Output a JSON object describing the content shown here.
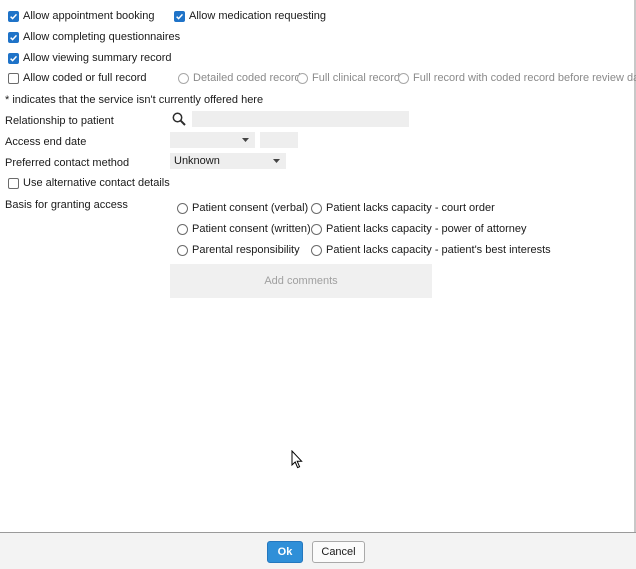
{
  "permissions": {
    "appointment_booking": {
      "label": "Allow appointment booking",
      "checked": true
    },
    "medication_requesting": {
      "label": "Allow medication requesting",
      "checked": true
    },
    "completing_questionnaires": {
      "label": "Allow completing questionnaires",
      "checked": true
    },
    "viewing_summary": {
      "label": "Allow viewing summary record",
      "checked": true
    },
    "coded_or_full": {
      "label": "Allow coded or full record",
      "checked": false
    }
  },
  "record_options": [
    {
      "label": "Detailed coded record"
    },
    {
      "label": "Full clinical record"
    },
    {
      "label": "Full record with coded record before review date"
    }
  ],
  "note": "* indicates that the service isn't currently offered here",
  "relationship": {
    "label": "Relationship to patient",
    "value": ""
  },
  "access_end_date": {
    "label": "Access end date",
    "date": "",
    "time": ""
  },
  "preferred_contact": {
    "label": "Preferred contact method",
    "value": "Unknown"
  },
  "alt_contact": {
    "label": "Use alternative contact details",
    "checked": false
  },
  "basis": {
    "label": "Basis for granting access",
    "col1": [
      "Patient consent (verbal)",
      "Patient consent (written)",
      "Parental responsibility"
    ],
    "col2": [
      "Patient lacks capacity - court order",
      "Patient lacks capacity - power of attorney",
      "Patient lacks capacity - patient's best interests"
    ]
  },
  "add_comments": "Add comments",
  "footer": {
    "ok": "Ok",
    "cancel": "Cancel"
  },
  "colors": {
    "accent": "#1f73c8",
    "ok_button": "#2f8fd8"
  }
}
